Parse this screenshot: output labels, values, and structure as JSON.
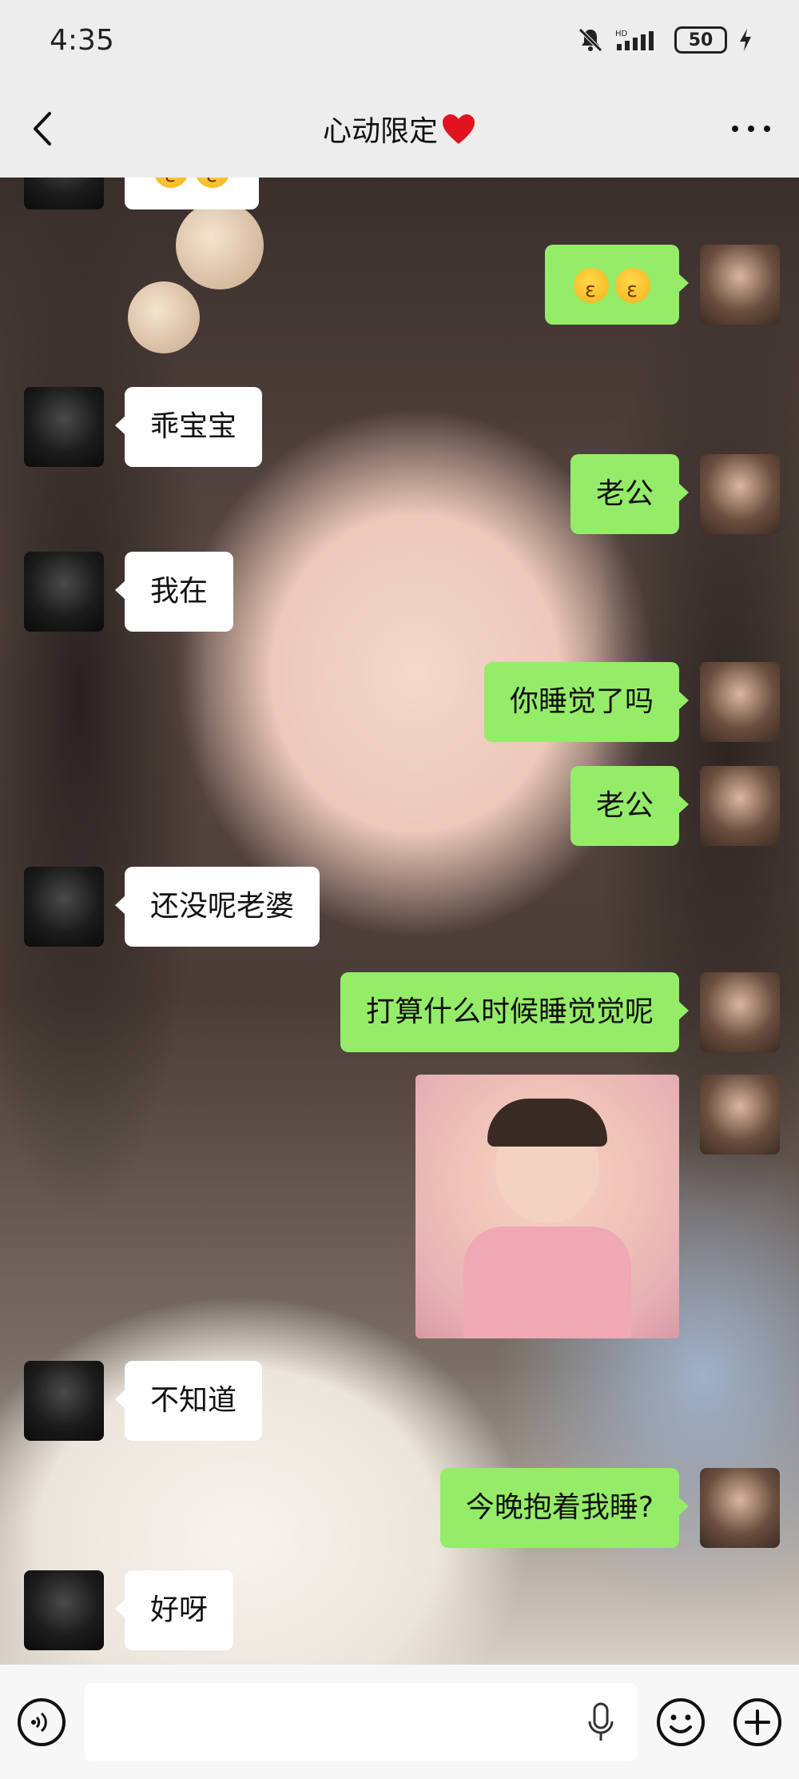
{
  "status_bar": {
    "time": "4:35",
    "battery": "50"
  },
  "header": {
    "title": "心动限定"
  },
  "messages": [
    {
      "side": "left",
      "text": ""
    },
    {
      "side": "right",
      "text": ""
    },
    {
      "side": "left",
      "text": "乖宝宝"
    },
    {
      "side": "right",
      "text": "老公"
    },
    {
      "side": "left",
      "text": "我在"
    },
    {
      "side": "right",
      "text": "你睡觉了吗"
    },
    {
      "side": "right",
      "text": "老公"
    },
    {
      "side": "left",
      "text": "还没呢老婆"
    },
    {
      "side": "right",
      "text": "打算什么时候睡觉觉呢"
    },
    {
      "side": "right",
      "text": ""
    },
    {
      "side": "left",
      "text": "不知道"
    },
    {
      "side": "right",
      "text": "今晚抱着我睡?"
    },
    {
      "side": "left",
      "text": "好呀"
    }
  ],
  "input_bar": {
    "placeholder": ""
  },
  "icons": {
    "back": "chevron-left-icon",
    "more": "more-icon",
    "voice": "voice-icon",
    "mic": "mic-icon",
    "emoji": "emoji-icon",
    "add": "plus-icon",
    "mute": "bell-off-icon",
    "signal": "signal-icon",
    "charging": "bolt-icon"
  },
  "colors": {
    "bubble_sent": "#95ec69",
    "bubble_received": "#ffffff",
    "heart": "#e0131f"
  }
}
